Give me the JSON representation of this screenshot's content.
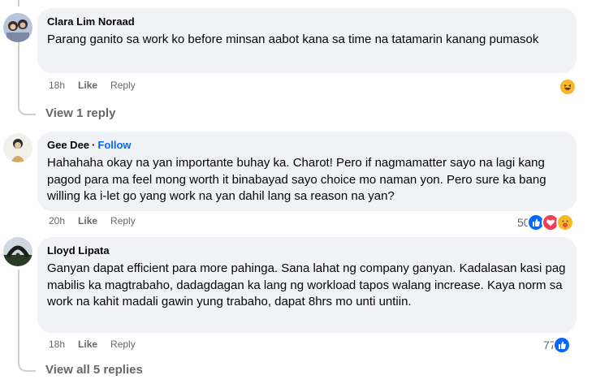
{
  "comments": [
    {
      "author": "Clara Lim Noraad",
      "text": "Parang ganito sa work ko before minsan aabot kana sa time na tatamarin kanang pumasok",
      "time": "18h",
      "like_label": "Like",
      "reply_label": "Reply",
      "reaction_icons": [
        "haha-icon"
      ],
      "view_replies": "View 1 reply"
    },
    {
      "author": "Gee Dee",
      "follow_label": "Follow",
      "text": "Hahahaha okay na yan importante buhay ka. Charot! Pero if nagmamatter sayo na lagi kang pagod para ma feel mong worth it binabayad sayo choice mo naman yon. Pero sure ka bang willing ka i-let go yang work na yan dahil lang sa reason na yan?",
      "time": "20h",
      "like_label": "Like",
      "reply_label": "Reply",
      "reaction_count": "50",
      "reaction_icons": [
        "like-icon",
        "love-icon",
        "care-icon"
      ]
    },
    {
      "author": "Lloyd Lipata",
      "text": "Ganyan dapat efficient para more pahinga. Sana lahat ng company ganyan. Kadalasan kasi pag mabilis ka magtrabaho, dadagdagan ka lang ng workload tapos walang increase. Kaya norm sa work na kahit madali gawin yung trabaho, dapat 8hrs mo unti untiin.",
      "time": "18h",
      "like_label": "Like",
      "reply_label": "Reply",
      "reaction_count": "77",
      "reaction_icons": [
        "like-icon"
      ],
      "view_replies": "View all 5 replies"
    }
  ],
  "colors": {
    "bubble": "#f0f2f5",
    "secondary_text": "#65676b",
    "link_blue": "#0866ff",
    "thread_line": "#ced0d4"
  }
}
